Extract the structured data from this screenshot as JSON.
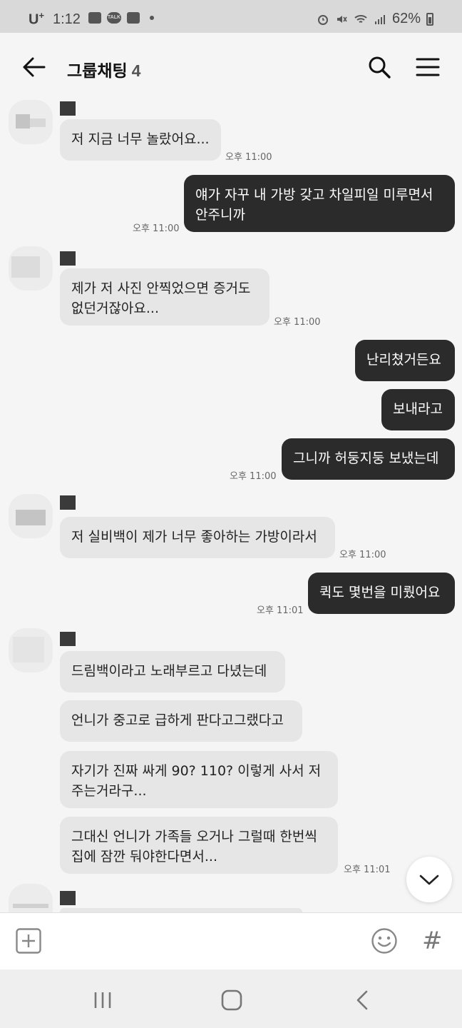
{
  "status_bar": {
    "carrier": "U",
    "carrier_sup": "+",
    "time": "1:12",
    "talk_label": "TALK",
    "battery": "62%"
  },
  "header": {
    "title": "그룹채팅",
    "member_count": "4"
  },
  "messages": [
    {
      "text": "저 지금 너무 놀랐어요...",
      "time": "오후 11:00"
    },
    {
      "text": "얘가 자꾸 내 가방 갖고 차일피일 미루면서\n안주니까",
      "time": "오후 11:00"
    },
    {
      "text": "제가 저 사진 안찍었으면 증거도\n없던거잖아요...",
      "time": "오후 11:00"
    },
    {
      "text": "난리쳤거든요"
    },
    {
      "text": "보내라고"
    },
    {
      "text": "그니까 허둥지둥 보냈는데",
      "time": "오후 11:00"
    },
    {
      "text": "저 실비백이 제가 너무 좋아하는 가방이라서",
      "time": "오후 11:00"
    },
    {
      "text": "퀵도 몇번을 미뤘어요",
      "time": "오후 11:01"
    },
    {
      "text": "드림백이라고 노래부르고 다녔는데"
    },
    {
      "text": "언니가 중고로 급하게 판다고그랬다고"
    },
    {
      "text": "자기가 진짜 싸게 90? 110? 이렇게 사서 저\n주는거라구..."
    },
    {
      "text": "그대신 언니가 가족들 오거나 그럴때 한번씩\n집에 잠깐 둬야한다면서...",
      "time": "오후 11:01"
    }
  ],
  "input": {
    "hash": "#"
  },
  "colors": {
    "incoming_bubble": "#e6e6e6",
    "outgoing_bubble": "#2b2b2b",
    "background": "#f5f5f5"
  }
}
